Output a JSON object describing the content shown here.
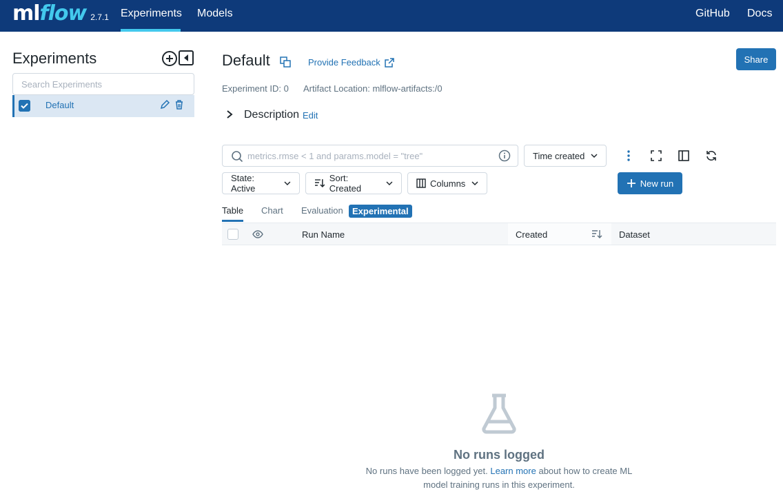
{
  "nav": {
    "logo_ml": "ml",
    "logo_flow": "flow",
    "version": "2.7.1",
    "items": [
      {
        "label": "Experiments",
        "active": true
      },
      {
        "label": "Models",
        "active": false
      }
    ],
    "right_items": [
      {
        "label": "GitHub"
      },
      {
        "label": "Docs"
      }
    ]
  },
  "sidebar": {
    "title": "Experiments",
    "search_placeholder": "Search Experiments",
    "experiments": [
      {
        "name": "Default",
        "selected": true
      }
    ]
  },
  "header": {
    "title": "Default",
    "feedback_label": "Provide Feedback",
    "share_label": "Share",
    "experiment_id": "Experiment ID: 0",
    "artifact_location": "Artifact Location: mlflow-artifacts:/0",
    "description_label": "Description",
    "description_edit": "Edit"
  },
  "toolbar": {
    "search_placeholder": "metrics.rmse < 1 and params.model = \"tree\"",
    "time_created": "Time created",
    "state": "State: Active",
    "sort": "Sort: Created",
    "columns": "Columns",
    "new_run": "New run"
  },
  "tabs": [
    {
      "label": "Table",
      "active": true
    },
    {
      "label": "Chart",
      "active": false
    },
    {
      "label": "Evaluation",
      "active": false
    }
  ],
  "experimental_tag": "Experimental",
  "table": {
    "columns": [
      "Run Name",
      "Created",
      "Dataset"
    ]
  },
  "empty": {
    "title": "No runs logged",
    "desc_prefix": "No runs have been logged yet.",
    "link": "Learn more",
    "desc_suffix": "about how to create ML model training runs in this experiment."
  },
  "colors": {
    "nav_bg": "#0e3a7a",
    "accent": "#2272b4",
    "logo_accent": "#43c9ed"
  }
}
